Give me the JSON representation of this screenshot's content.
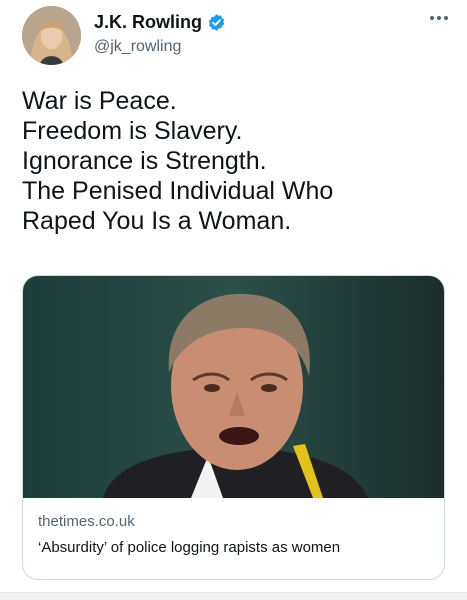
{
  "author": {
    "display_name": "J.K. Rowling",
    "handle": "@jk_rowling",
    "verified": true,
    "verified_icon": "verified-badge-icon",
    "avatar_icon": "profile-photo"
  },
  "more_icon": "more-dots-icon",
  "tweet": {
    "lines": [
      "War is Peace.",
      "Freedom is Slavery.",
      "Ignorance is Strength.",
      "The Penised Individual Who",
      "Raped You Is a Woman."
    ]
  },
  "link_card": {
    "domain": "thetimes.co.uk",
    "title": "‘Absurdity’ of police logging rapists as women",
    "image_icon": "article-photo"
  },
  "colors": {
    "text": "#0f1419",
    "secondary": "#536471",
    "verified": "#1d9bf0",
    "border": "#cfd9de"
  }
}
